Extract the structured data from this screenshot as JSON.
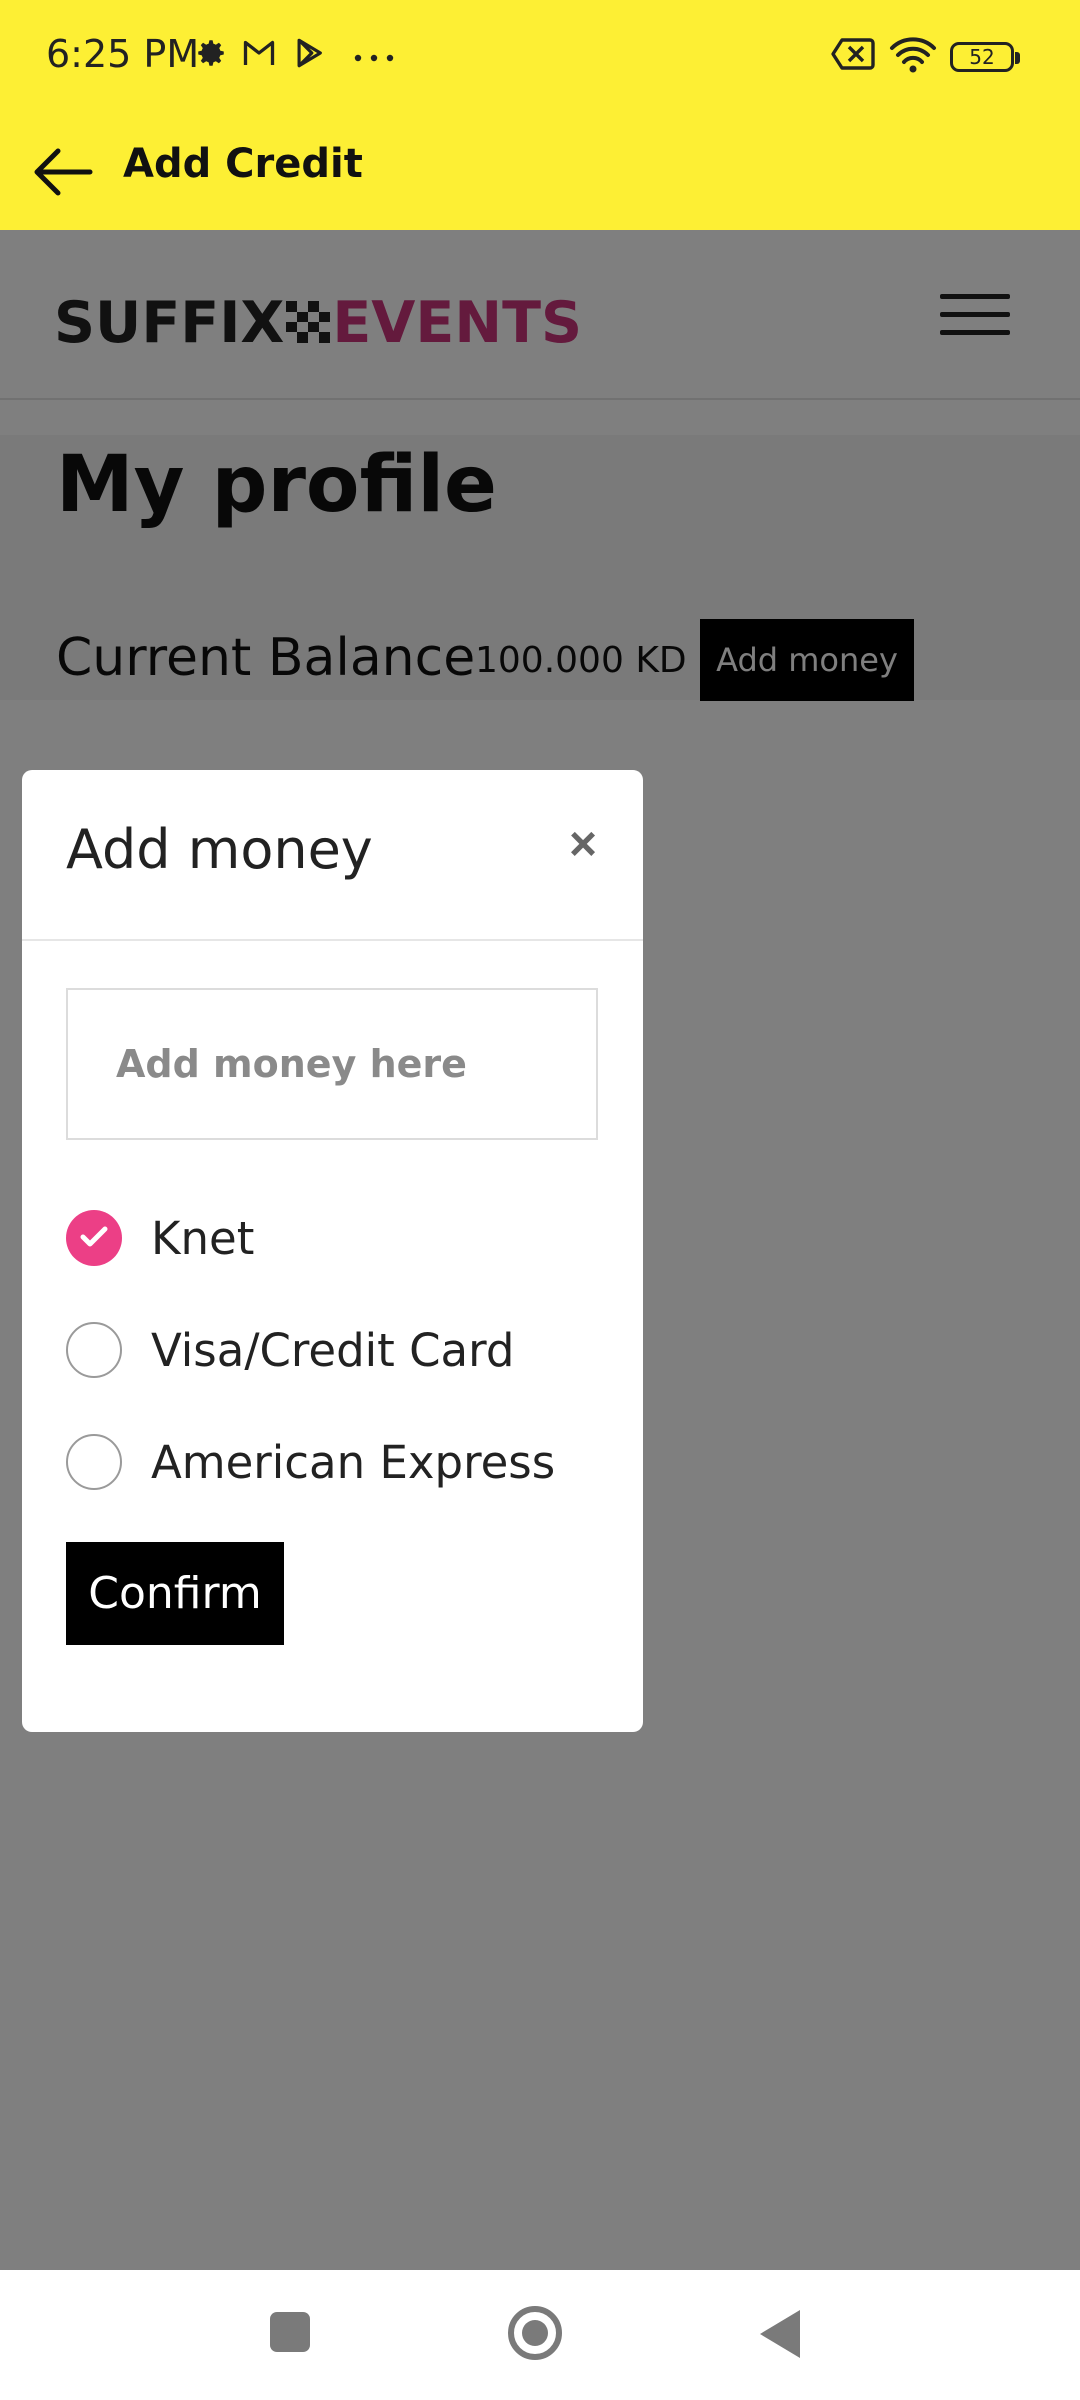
{
  "status_bar": {
    "time": "6:25 PM",
    "battery": "52",
    "icons": [
      "gear-icon",
      "gmail-icon",
      "play-store-icon",
      "more-dots-icon",
      "no-sim-icon",
      "wifi-icon",
      "battery-icon"
    ]
  },
  "app_bar": {
    "title": "Add Credit",
    "back_icon": "arrow-left-icon"
  },
  "site": {
    "logo_left": "SUFFIX",
    "logo_right": "EVENTS",
    "menu_icon": "hamburger-menu-icon"
  },
  "profile": {
    "title": "My profile",
    "balance_label": "Current Balance",
    "balance_value": "100.000 KD",
    "add_money_label": "Add money"
  },
  "modal": {
    "title": "Add money",
    "close_label": "×",
    "amount_placeholder": "Add money here",
    "payment_options": [
      {
        "label": "Knet",
        "selected": true
      },
      {
        "label": "Visa/Credit Card",
        "selected": false
      },
      {
        "label": "American Express",
        "selected": false
      }
    ],
    "confirm_label": "Confirm"
  },
  "colors": {
    "top_bar": "#fdef34",
    "accent_pink": "#ec3f86",
    "logo_pink": "#c8357a"
  },
  "nav_bar": {
    "icons": [
      "recents-square-icon",
      "home-circle-icon",
      "back-triangle-icon"
    ]
  }
}
